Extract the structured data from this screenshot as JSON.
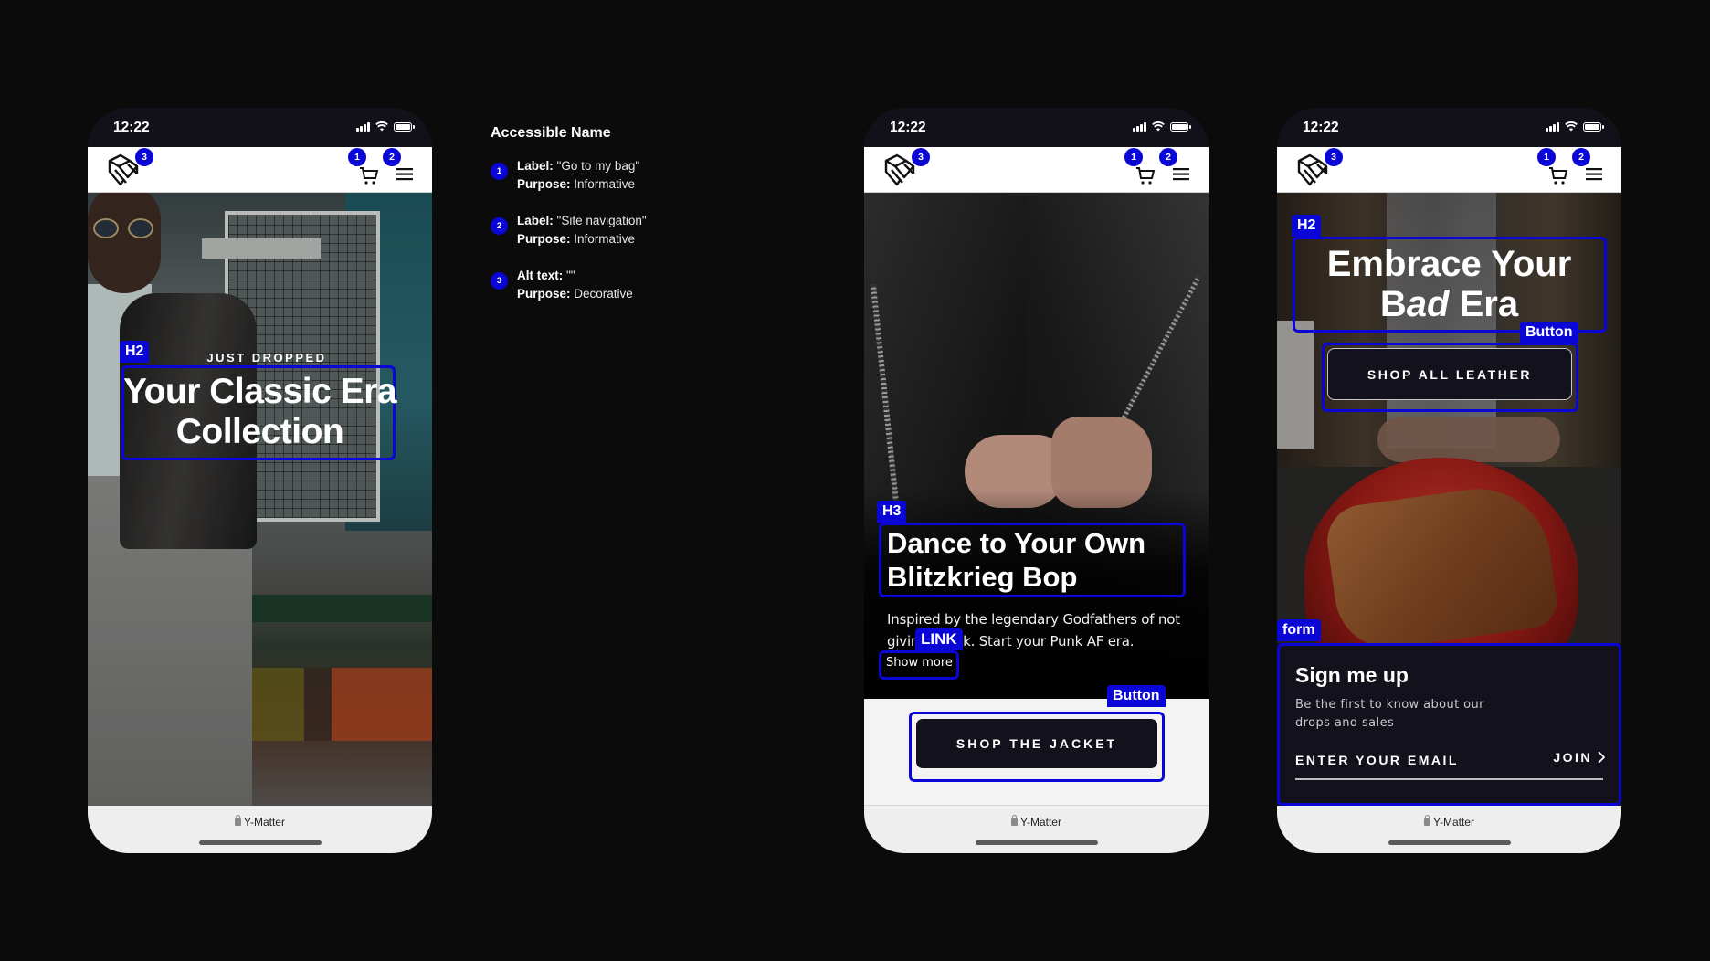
{
  "legend": {
    "title": "Accessible Name",
    "items": [
      {
        "num": "1",
        "k1": "Label:",
        "v1": "\"Go to my bag\"",
        "k2": "Purpose:",
        "v2": "Informative"
      },
      {
        "num": "2",
        "k1": "Label:",
        "v1": "\"Site navigation\"",
        "k2": "Purpose:",
        "v2": "Informative"
      },
      {
        "num": "3",
        "k1": "Alt text:",
        "v1": "\"\"",
        "k2": "Purpose:",
        "v2": "Decorative"
      }
    ]
  },
  "common": {
    "time": "12:22",
    "site": "Y-Matter",
    "badges": {
      "cart": "1",
      "menu": "2",
      "logo": "3"
    },
    "icons": {
      "logo": "brand-logo-icon",
      "cart": "cart-icon",
      "menu": "hamburger-menu-icon",
      "lock": "lock-icon",
      "signal": "signal-icon",
      "wifi": "wifi-icon",
      "battery": "battery-icon"
    }
  },
  "phone1": {
    "kicker": "JUST DROPPED",
    "title_line1": "Your Classic Era",
    "title_line2": "Collection",
    "tag_heading": "H2"
  },
  "phone2": {
    "title_line1": "Dance to Your Own",
    "title_line2": "Blitzkrieg Bop",
    "body_line1": "Inspired by the legendary Godfathers of not",
    "body_line2": "giving a f*ck. Start your Punk AF era.",
    "link": "Show more",
    "button": "SHOP THE JACKET",
    "tag_heading": "H3",
    "tag_link": "LINK",
    "tag_button": "Button"
  },
  "phone3": {
    "title_line1": "Embrace Your",
    "title_line2_a": "B",
    "title_line2_em": "ad",
    "title_line2_b": " Era",
    "button": "SHOP ALL LEATHER",
    "form_title": "Sign me up",
    "form_sub": "Be the first to know about our drops and sales",
    "email_placeholder": "ENTER YOUR EMAIL",
    "join": "JOIN",
    "tag_heading": "H2",
    "tag_button": "Button",
    "tag_form": "form"
  },
  "colors": {
    "annotation": "#0a06d6",
    "background": "#0b0b0c",
    "dark_button": "#13111b"
  }
}
